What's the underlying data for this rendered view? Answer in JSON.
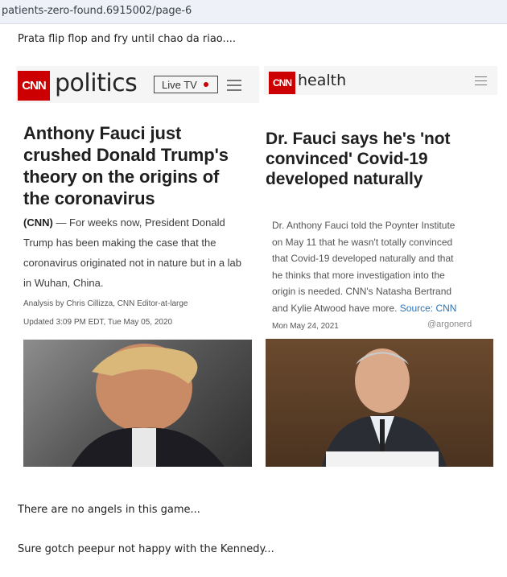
{
  "browser": {
    "url": "patients-zero-found.6915002/page-6"
  },
  "post": {
    "line1": "Prata flip flop and fry until chao da riao....",
    "line2": "There are no angels in this game...",
    "line3": "Sure gotch peepur not happy with the Kennedy..."
  },
  "left_card": {
    "logo": "CNN",
    "section": "politics",
    "live_label": "Live TV",
    "headline_lines": [
      "Anthony Fauci just",
      "crushed Donald Trump's",
      "theory on the origins of",
      "the coronavirus"
    ],
    "source": "(CNN)",
    "body_lines": [
      " — For weeks now, President Donald",
      "Trump has been making the case that the",
      "coronavirus originated not in nature but in a lab",
      "in Wuhan, China."
    ],
    "byline": "Analysis by Chris Cillizza, CNN Editor-at-large",
    "updated": "Updated 3:09 PM EDT, Tue May 05, 2020"
  },
  "right_card": {
    "logo": "CNN",
    "section": "health",
    "headline_lines": [
      "Dr. Fauci says he's 'not",
      "convinced' Covid-19",
      "developed naturally"
    ],
    "body_lines": [
      "Dr. Anthony Fauci told the Poynter Institute",
      "on May 11 that he wasn't totally convinced",
      "that Covid-19 developed naturally and that",
      "he thinks that more investigation into the",
      "origin is needed. CNN's Natasha Bertrand",
      "and Kylie Atwood have more."
    ],
    "source_link": "Source: CNN",
    "date": "Mon May 24, 2021",
    "handle": "@argonerd"
  },
  "colors": {
    "cnn_red": "#cc0000",
    "link_blue": "#2a74b8",
    "page_bg": "#ffffff"
  }
}
